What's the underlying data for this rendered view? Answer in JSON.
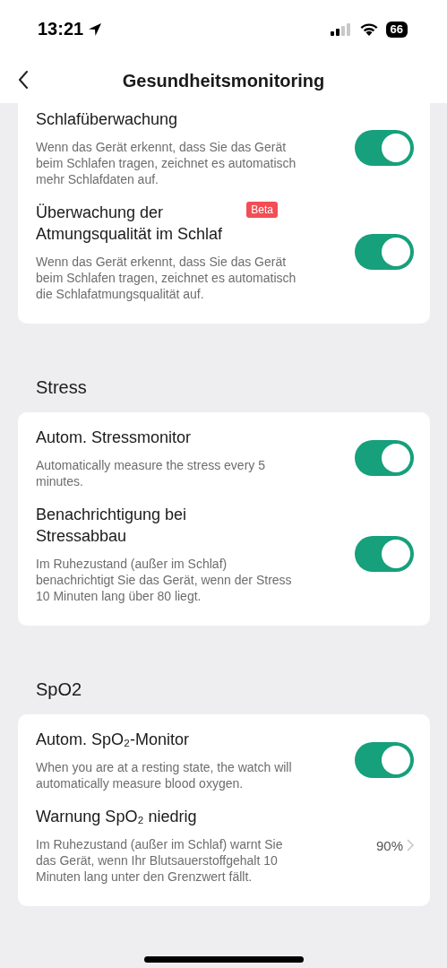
{
  "status_bar": {
    "time": "13:21",
    "battery": "66"
  },
  "nav": {
    "title": "Gesundheitsmonitoring"
  },
  "sections": [
    {
      "items": [
        {
          "kind": "toggle",
          "title": "Schlafüberwachung",
          "description": "Wenn das Gerät erkennt, dass Sie das Gerät beim Schlafen tragen, zeichnet es automatisch mehr Schlafdaten auf.",
          "on": true
        },
        {
          "kind": "toggle",
          "title": "Überwachung der Atmungsqualität im Schlaf",
          "badge": "Beta",
          "description": "Wenn das Gerät erkennt, dass Sie das Gerät beim Schlafen tragen, zeichnet es automatisch die Schlafatmungsqualität auf.",
          "on": true
        }
      ]
    },
    {
      "header": "Stress",
      "items": [
        {
          "kind": "toggle",
          "title": "Autom. Stressmonitor",
          "description": "Automatically measure the stress every 5 minutes.",
          "on": true
        },
        {
          "kind": "toggle",
          "title": "Benachrichtigung bei Stressabbau",
          "description": "Im Ruhezustand (außer im Schlaf) benachrichtigt Sie das Gerät, wenn der Stress 10 Minuten lang über 80 liegt.",
          "on": true
        }
      ]
    },
    {
      "header": "SpO2",
      "items": [
        {
          "kind": "toggle",
          "title": "Autom. SpO₂-Monitor",
          "description": "When you are at a resting state, the watch will automatically measure blood oxygen.",
          "on": true
        },
        {
          "kind": "value",
          "title": "Warnung SpO₂ niedrig",
          "description": "Im Ruhezustand (außer im Schlaf) warnt Sie das Gerät, wenn Ihr Blutsauerstoffgehalt 10 Minuten lang unter den Grenzwert fällt.",
          "value": "90%"
        }
      ]
    }
  ]
}
